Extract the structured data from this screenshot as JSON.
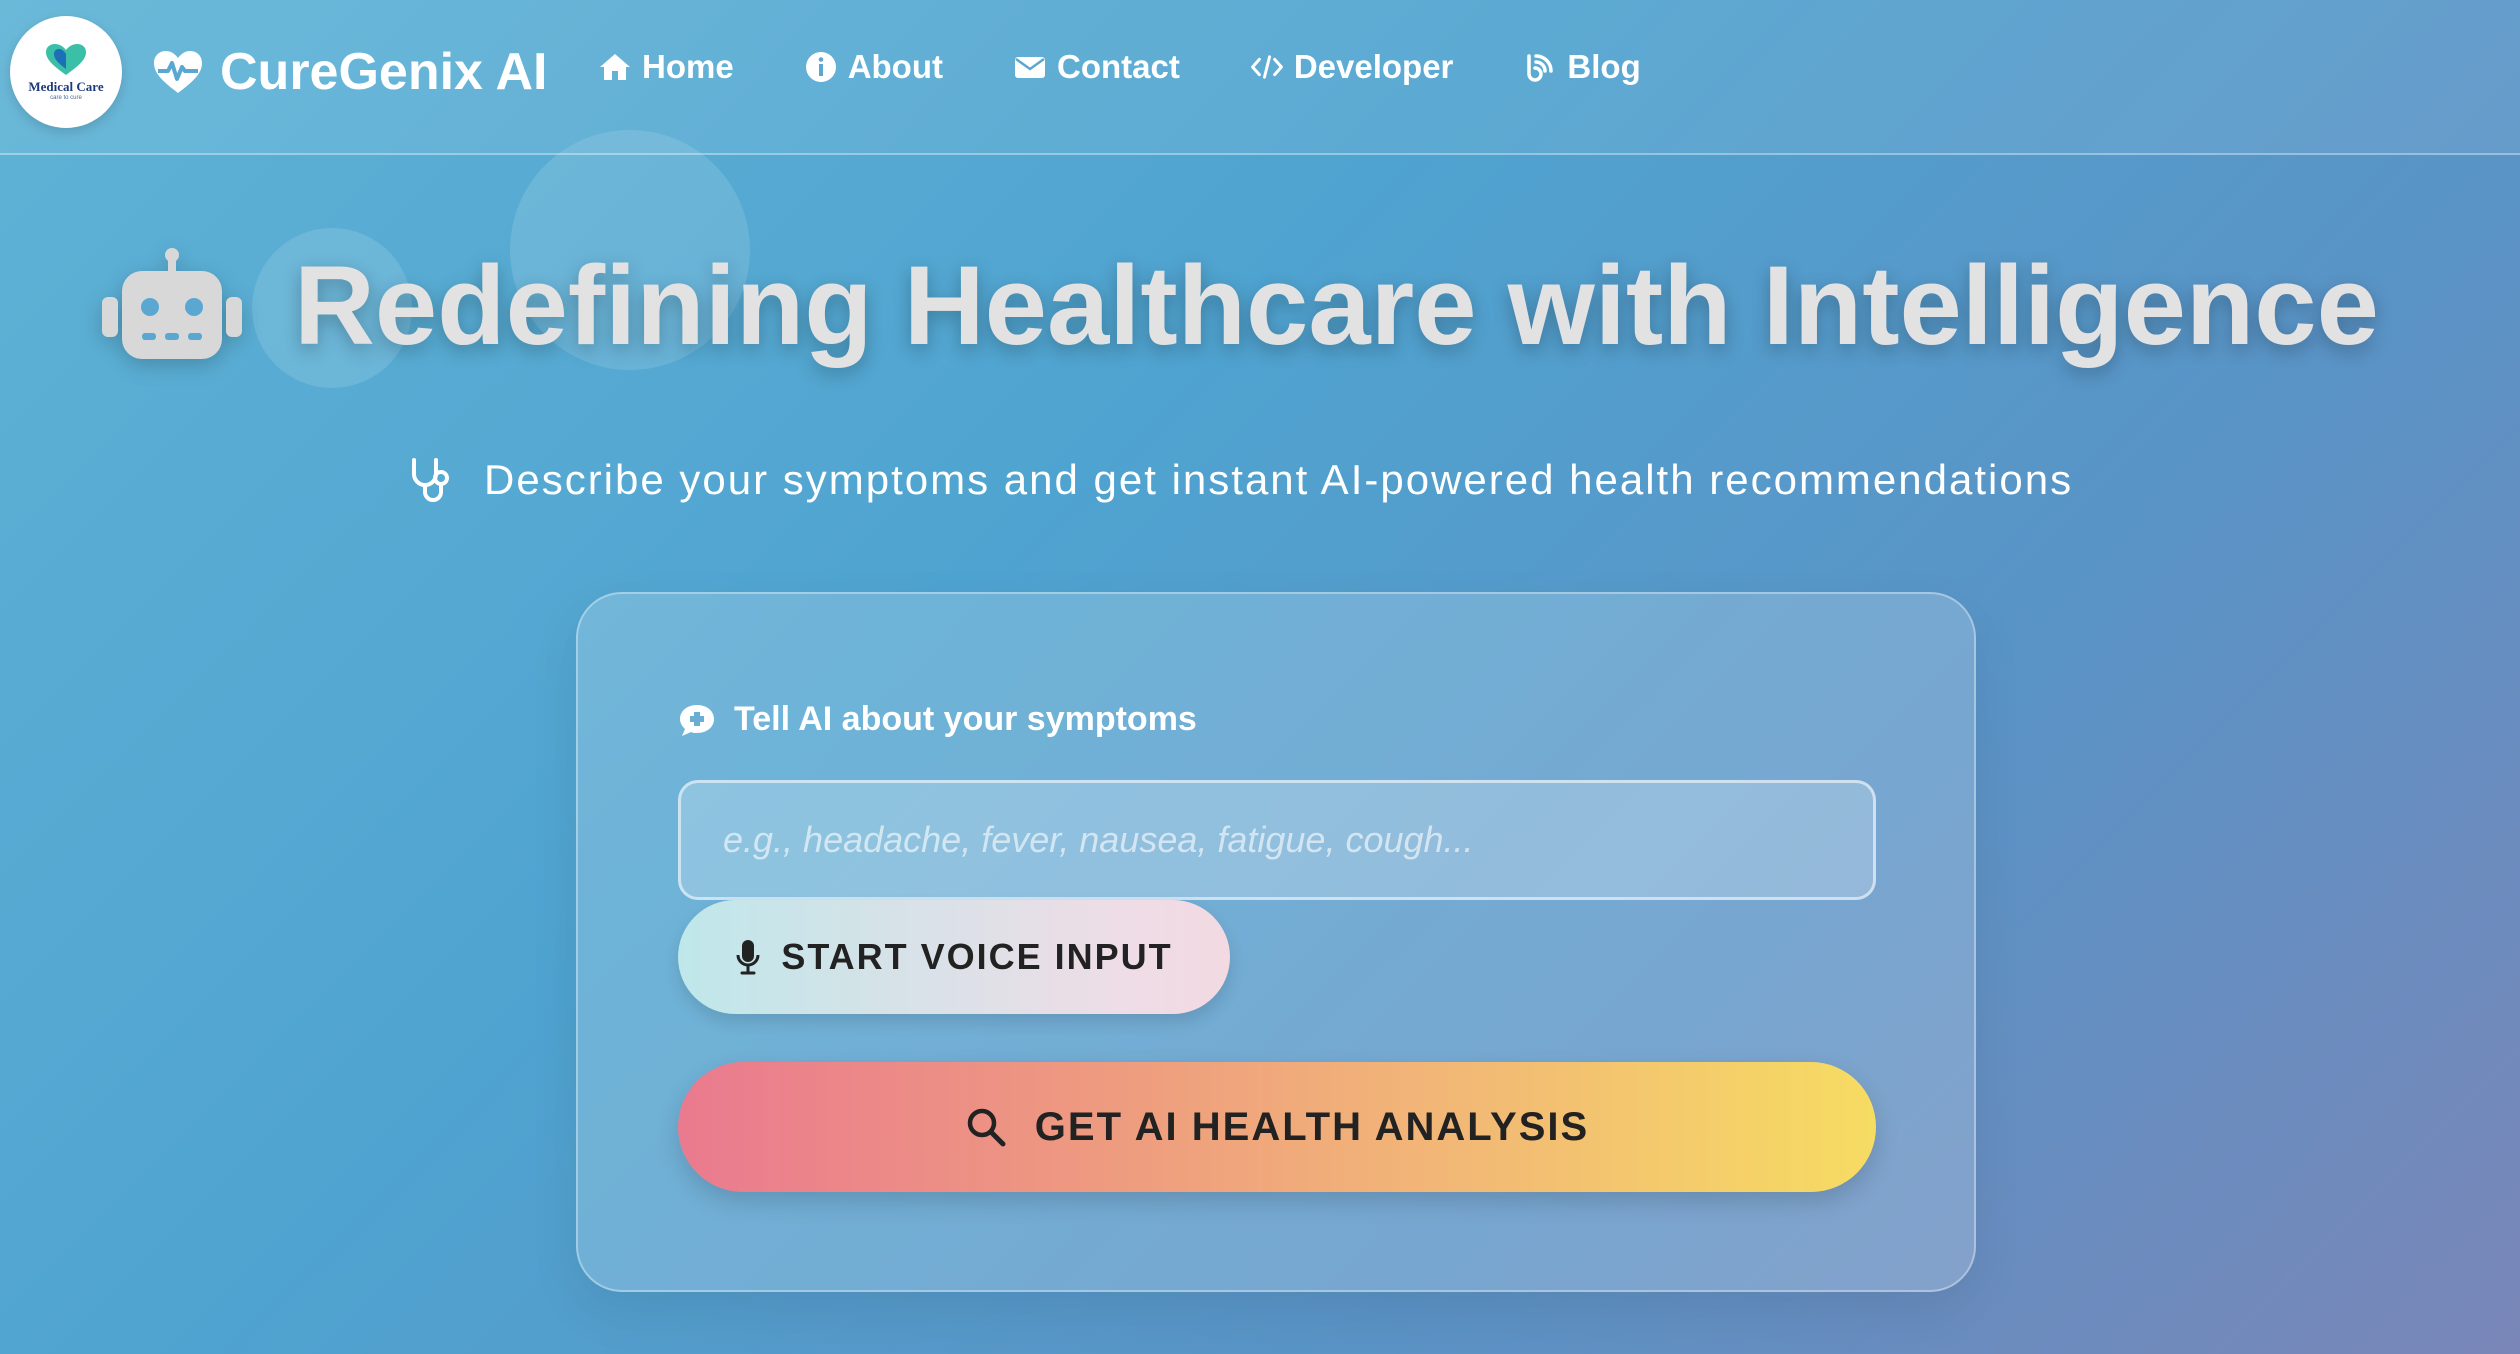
{
  "logo": {
    "text": "Medical Care",
    "tagline": "care to cure"
  },
  "brand": {
    "name": "CureGenix AI",
    "icon": "heart-pulse-icon"
  },
  "nav": {
    "items": [
      {
        "label": "Home",
        "icon": "home-icon"
      },
      {
        "label": "About",
        "icon": "info-icon"
      },
      {
        "label": "Contact",
        "icon": "envelope-icon"
      },
      {
        "label": "Developer",
        "icon": "code-icon"
      },
      {
        "label": "Blog",
        "icon": "blog-icon"
      }
    ]
  },
  "hero": {
    "title": "Redefining Healthcare with Intelligence",
    "title_icon": "robot-icon",
    "subtitle": "Describe your symptoms and get instant AI-powered health recommendations",
    "subtitle_icon": "stethoscope-icon"
  },
  "form": {
    "label": "Tell AI about your symptoms",
    "label_icon": "comment-medical-icon",
    "input_placeholder": "e.g., headache, fever, nausea, fatigue, cough...",
    "input_value": "",
    "voice_button": "START VOICE INPUT",
    "voice_icon": "microphone-icon",
    "analyze_button": "GET AI HEALTH ANALYSIS",
    "analyze_icon": "search-icon"
  },
  "colors": {
    "background_start": "#5fb3d6",
    "background_end": "#7a86b8",
    "analyze_gradient_start": "#ea7a8f",
    "analyze_gradient_end": "#f6dc62",
    "voice_gradient_start": "#bfe7ea",
    "voice_gradient_end": "#f3d9e2"
  }
}
